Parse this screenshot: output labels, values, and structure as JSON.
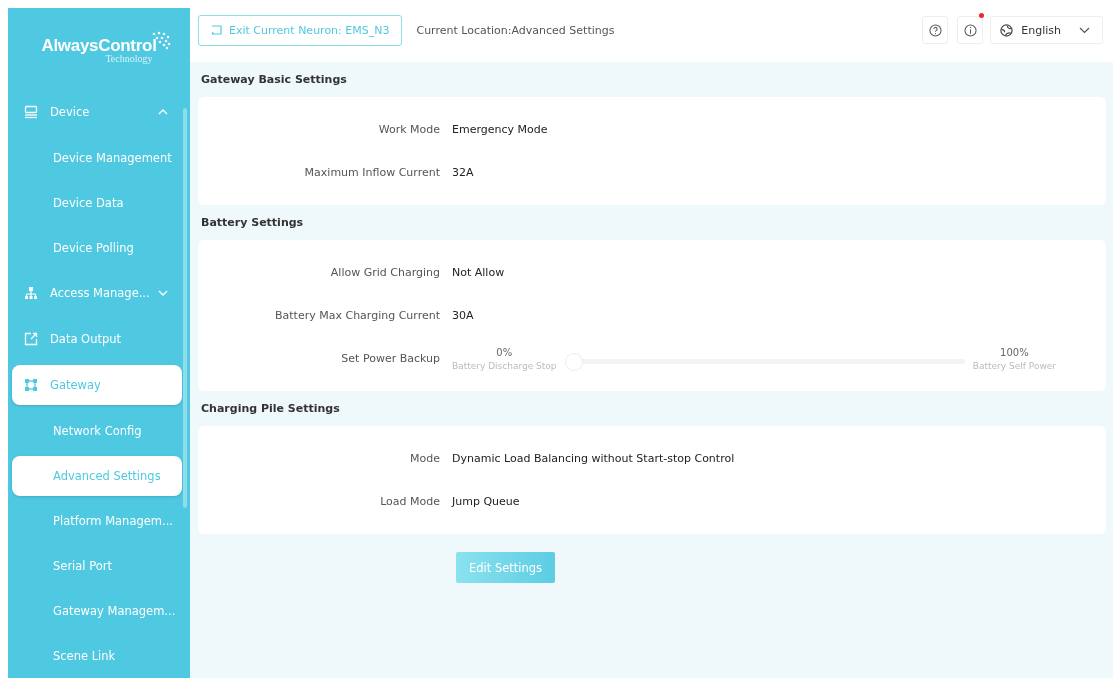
{
  "logo": {
    "name": "AlwaysControl",
    "subtitle": "Technology"
  },
  "sidebar": {
    "items": [
      {
        "label": "Device",
        "expanded": true,
        "selected": false,
        "children": [
          {
            "label": "Device Management",
            "selected": false
          },
          {
            "label": "Device Data",
            "selected": false
          },
          {
            "label": "Device Polling",
            "selected": false
          }
        ]
      },
      {
        "label": "Access Manage...",
        "expanded": false,
        "selected": false
      },
      {
        "label": "Data Output",
        "selected": false
      },
      {
        "label": "Gateway",
        "selected": true,
        "children": [
          {
            "label": "Network Config",
            "selected": false
          },
          {
            "label": "Advanced Settings",
            "selected": true
          },
          {
            "label": "Platform Managem...",
            "selected": false
          },
          {
            "label": "Serial Port",
            "selected": false
          },
          {
            "label": "Gateway Managem...",
            "selected": false
          },
          {
            "label": "Scene Link",
            "selected": false
          }
        ]
      }
    ]
  },
  "header": {
    "exit_button": "Exit Current Neuron: EMS_N3",
    "location": "Current Location:Advanced Settings",
    "notification_dot": true,
    "language": "English"
  },
  "sections": [
    {
      "title": "Gateway Basic Settings",
      "rows": [
        {
          "kind": "text",
          "label": "Work Mode",
          "value": "Emergency Mode"
        },
        {
          "kind": "text",
          "label": "Maximum Inflow Current",
          "value": "32A"
        }
      ]
    },
    {
      "title": "Battery Settings",
      "rows": [
        {
          "kind": "text",
          "label": "Allow Grid Charging",
          "value": "Not Allow"
        },
        {
          "kind": "text",
          "label": "Battery Max Charging Current",
          "value": "30A"
        },
        {
          "kind": "slider",
          "label": "Set Power Backup",
          "level": 0,
          "min_value": "0%",
          "min_caption": "Battery Discharge Stop",
          "max_value": "100%",
          "max_caption": "Battery Self Power"
        }
      ]
    },
    {
      "title": "Charging Pile Settings",
      "rows": [
        {
          "kind": "text",
          "label": "Mode",
          "value": "Dynamic Load Balancing without Start-stop Control"
        },
        {
          "kind": "text",
          "label": "Load Mode",
          "value": "Jump Queue"
        }
      ]
    }
  ],
  "edit_button": "Edit Settings"
}
